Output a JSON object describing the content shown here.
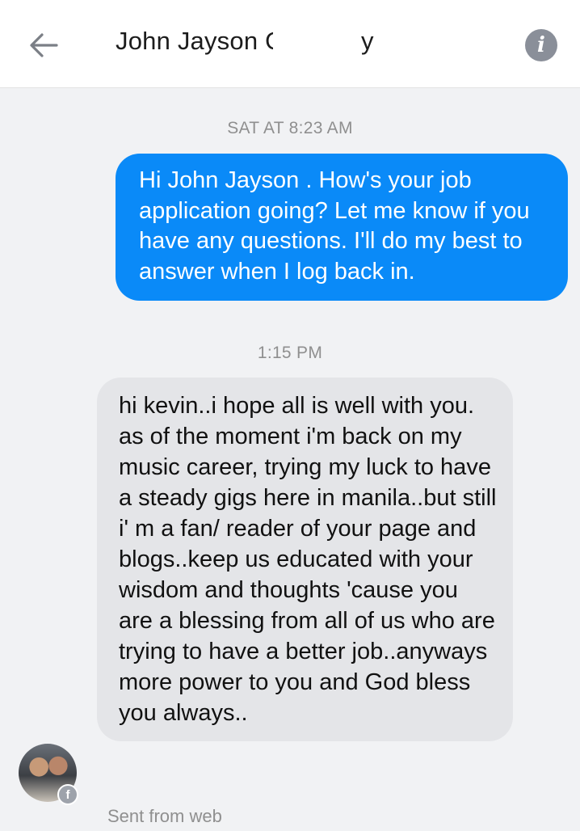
{
  "header": {
    "contact_name": "John Jayson O",
    "contact_name_tail": "y",
    "back_icon": "arrow-left-icon",
    "info_icon": "info-icon",
    "info_glyph": "i"
  },
  "conversation": {
    "timestamp_1": "SAT AT 8:23 AM",
    "outgoing_message": "Hi John Jayson . How's your job application going? Let me know if you have any questions. I'll do my best to answer when I log back in.",
    "timestamp_2": "1:15 PM",
    "incoming_message": "hi kevin..i hope all is well with you. as of the moment i'm back on my music career, trying my luck to have a steady gigs here in manila..but still i' m a fan/ reader of your page and blogs..keep us educated with your wisdom and thoughts 'cause you are a blessing from all of us who are trying to have a better job..anyways more power to you and God bless you always..",
    "sender_badge": "f",
    "sent_from": "Sent from web"
  },
  "colors": {
    "outgoing_bubble": "#0a8af8",
    "incoming_bubble": "#e4e5e8",
    "chat_background": "#f1f2f4"
  }
}
